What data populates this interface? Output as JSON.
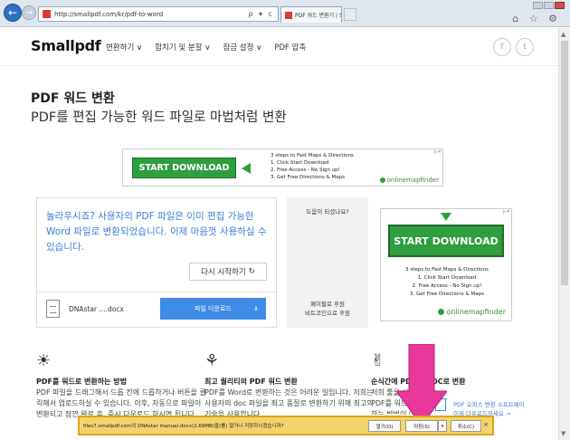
{
  "browser": {
    "url": "http://smallpdf.com/kr/pdf-to-word",
    "address_tools": "ρ ▾ c",
    "tab_title": "PDF 워드 변환기 | Smallp...",
    "tab_close": "×",
    "right_icons": "⌂ ☆ ⚙"
  },
  "header": {
    "logo": "Smallpdf",
    "menu": [
      "변환하기 ∨",
      "합치기 및 분할 ∨",
      "잠금 설정 ∨",
      "PDF 압축"
    ],
    "facebook": "f",
    "twitter": "t"
  },
  "page": {
    "title": "PDF 워드 변환",
    "subtitle": "PDF를 편집 가능한 워드 파일로 마법처럼 변환"
  },
  "ad_top": {
    "badge": "▷✕",
    "button": "START DOWNLOAD",
    "steps_head": "3 steps to Fast Maps & Directions",
    "steps": [
      "1. Click Start Download",
      "2. Free Access - No Sign up!",
      "3. Get Free Directions & Maps"
    ],
    "brand": "onlinemapfinder"
  },
  "result": {
    "message": "놀라우시죠? 사용자의 PDF 파일은 이미 편집 가능한 Word 파일로 변환되었습니다. 이제 마음껏 사용하실 수 있습니다.",
    "restart_label": "다시 시작하기",
    "restart_icon": "↻",
    "file_name": "DNAstar ....docx",
    "download_label": "파일 다운로드",
    "download_icon": "⇓"
  },
  "help": {
    "question": "도움이 되셨나요?",
    "donate": "페이팔로 후원\n비트코인으로 후원"
  },
  "ad_side": {
    "badge": "▷✕",
    "button": "START DOWNLOAD",
    "steps_head": "3 steps to Fast Maps & Directions",
    "steps": [
      "1. Click Start Download",
      "2. Free Access - No Sign up!",
      "3. Get Free Directions & Maps"
    ],
    "brand": "onlinemapfinder"
  },
  "features": [
    {
      "icon": "☀",
      "title": "PDF를 워드로 변환하는 방법",
      "text": "PDF 파일을 드래그해서 드롭 칸에 드롭하거나 버튼을 클릭해서 업로드하실 수 있습니다. 이후, 자동으로 파일이 변환되고 잠깐 완료 후, 즉시 다운로드 하시면 됩니다."
    },
    {
      "icon": "⚘",
      "title": "최고 퀄리티의 PDF 워드 변환",
      "text": "PDF를 Word로 변환하는 것은 어려운 일입니다. 저희는 사용자의 doc 파일을 최고 품질로 변환하기 위해 최고의 기술을 사용합니다."
    },
    {
      "icon": "✌",
      "title": "순식간에 PDF를 DOC로 변환",
      "text": "저희 툴을 사용하면 PDF를 워드로 변환하는 방법이 아주 간단합니다. 바로 시작하세요."
    }
  ],
  "promo": {
    "text": "PDF 오피스 변환 소프트웨어\n이제 다운로드하세요 →"
  },
  "download_bar": {
    "message": "files7.smallpdf.com의 DNAstar manual.docx(2.69MB)을(를) 열거나 저장하시겠습니까?",
    "open": "열기(O)",
    "save": "저장(S)",
    "dropdown": "▾",
    "cancel": "취소(C)",
    "close": "×"
  },
  "colors": {
    "accent_blue": "#3f8ce8",
    "ad_green": "#2f9e3e",
    "bar_yellow": "#f3d36b",
    "pink_arrow": "#e9379a"
  }
}
